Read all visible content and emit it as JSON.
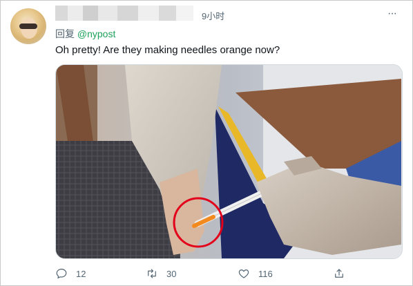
{
  "tweet": {
    "time": "9小时",
    "more": "···",
    "reply_prefix": "回复",
    "reply_handle": "@nypost",
    "text": "Oh pretty! Are they making needles orange now?"
  },
  "actions": {
    "reply_count": "12",
    "retweet_count": "30",
    "like_count": "116"
  },
  "colors": {
    "handle": "#1da15a",
    "highlight_circle": "#e3001b",
    "syringe_fluid": "#f28a1f"
  },
  "icons": [
    "avatar",
    "more-icon",
    "reply-icon",
    "retweet-icon",
    "like-icon",
    "share-icon"
  ]
}
